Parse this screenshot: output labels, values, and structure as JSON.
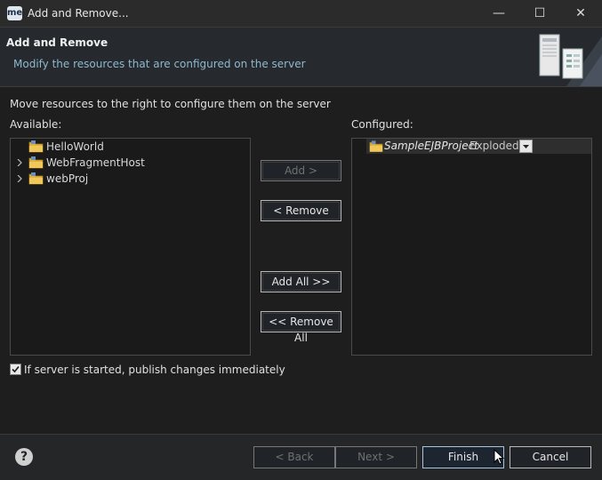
{
  "window": {
    "app_icon_text": "me",
    "title": "Add and Remove...",
    "minimize_glyph": "—",
    "maximize_glyph": "☐",
    "close_glyph": "✕"
  },
  "header": {
    "title": "Add and Remove",
    "description": "Modify the resources that are configured on the server",
    "banner_icon": "server-banner-icon"
  },
  "main": {
    "instruction": "Move resources to the right to configure them on the server",
    "available_label": "Available:",
    "configured_label": "Configured:",
    "available_items": [
      {
        "label": "HelloWorld",
        "expandable": false
      },
      {
        "label": "WebFragmentHost",
        "expandable": true
      },
      {
        "label": "webProj",
        "expandable": true
      }
    ],
    "configured_items": [
      {
        "label": "SampleEJBProject",
        "mode": "Exploded"
      }
    ],
    "buttons": {
      "add": "Add >",
      "remove": "< Remove",
      "add_all": "Add All >>",
      "remove_all": "<< Remove All"
    },
    "publish_checkbox": {
      "label": "If server is started, publish changes immediately",
      "checked": true
    }
  },
  "footer": {
    "help_glyph": "?",
    "back": "< Back",
    "next": "Next >",
    "finish": "Finish",
    "cancel": "Cancel"
  },
  "colors": {
    "background": "#1e1e1e",
    "panel": "#1a1a1a",
    "header_desc": "#8fb8cc",
    "folder": "#e2b23e"
  }
}
